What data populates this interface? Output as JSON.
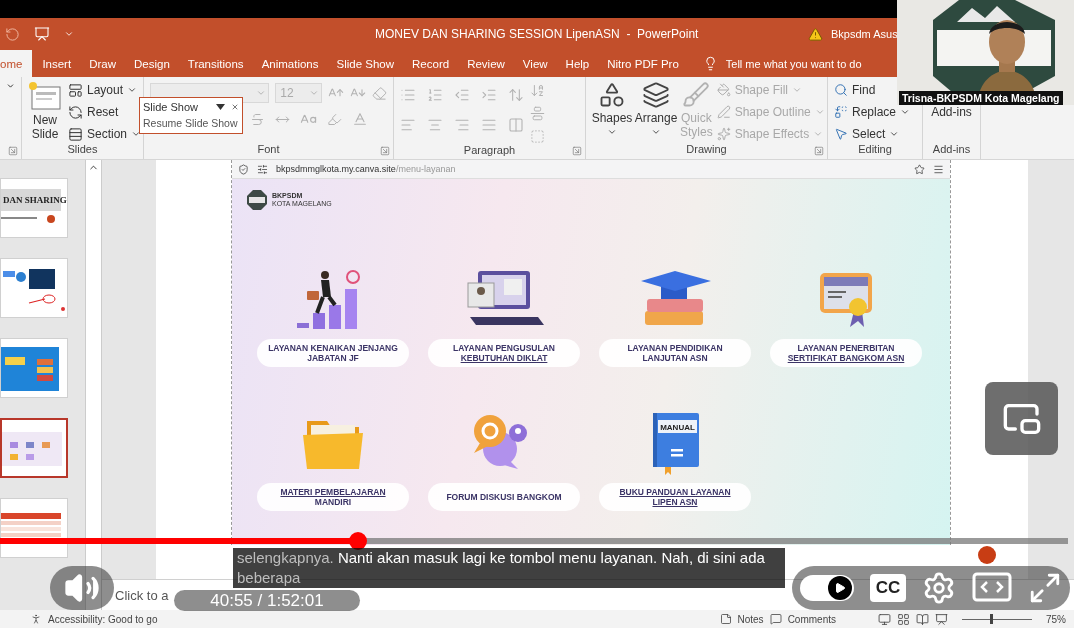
{
  "window": {
    "title": "MONEV DAN SHARING SESSION LipenASN  -  PowerPoint",
    "user": "Bkpsdm Asus"
  },
  "tabs": [
    {
      "label": "ome",
      "selected": true
    },
    {
      "label": "Insert",
      "selected": false
    },
    {
      "label": "Draw",
      "selected": false
    },
    {
      "label": "Design",
      "selected": false
    },
    {
      "label": "Transitions",
      "selected": false
    },
    {
      "label": "Animations",
      "selected": false
    },
    {
      "label": "Slide Show",
      "selected": false
    },
    {
      "label": "Record",
      "selected": false
    },
    {
      "label": "Review",
      "selected": false
    },
    {
      "label": "View",
      "selected": false
    },
    {
      "label": "Help",
      "selected": false
    },
    {
      "label": "Nitro PDF Pro",
      "selected": false
    }
  ],
  "tell_me": {
    "placeholder": "Tell me what you want to do"
  },
  "ribbon": {
    "groups": [
      {
        "kind": "slides",
        "label": "Slides",
        "new_slide": "New Slide",
        "items": [
          {
            "label": "Layout",
            "menu": true
          },
          {
            "label": "Reset",
            "menu": false
          },
          {
            "label": "Section",
            "menu": true
          }
        ]
      },
      {
        "kind": "font",
        "label": "Font",
        "size": "12",
        "disabled": true
      },
      {
        "kind": "paragraph",
        "label": "Paragraph",
        "disabled": true
      },
      {
        "kind": "drawing",
        "label": "Drawing",
        "large": [
          {
            "label": "Shapes",
            "disabled": false
          },
          {
            "label": "Arrange",
            "disabled": false
          },
          {
            "label": "Quick Styles",
            "disabled": true
          }
        ],
        "small": [
          {
            "label": "Shape Fill",
            "disabled": true
          },
          {
            "label": "Shape Outline",
            "disabled": true
          },
          {
            "label": "Shape Effects",
            "disabled": true
          }
        ]
      },
      {
        "kind": "editing",
        "label": "Editing",
        "items": [
          {
            "label": "Find",
            "menu": false
          },
          {
            "label": "Replace",
            "menu": true
          },
          {
            "label": "Select",
            "menu": true
          }
        ]
      },
      {
        "kind": "addins",
        "label": "Add-ins",
        "button": "Add-ins"
      }
    ]
  },
  "popup": {
    "title": "Slide Show",
    "item": "Resume Slide Show"
  },
  "thumbnails": [
    {
      "kind": "title",
      "caption": "DAN SHARING",
      "selected": false
    },
    {
      "kind": "screens",
      "selected": false
    },
    {
      "kind": "books",
      "selected": false
    },
    {
      "kind": "menu",
      "selected": true
    },
    {
      "kind": "table",
      "selected": false
    }
  ],
  "browser": {
    "url_host": "bkpsdmmglkota.my.canva.site",
    "url_path": "/menu-layanan"
  },
  "site": {
    "logo": {
      "name": "BKPSDM",
      "city": "KOTA MAGELANG"
    },
    "services": [
      {
        "kind": "climber",
        "lines": [
          {
            "text": "LAYANAN KENAIKAN JENJANG",
            "underlined": false
          },
          {
            "text": "JABATAN JF",
            "underlined": false
          }
        ]
      },
      {
        "kind": "laptop",
        "lines": [
          {
            "text": "LAYANAN PENGUSULAN",
            "underlined": false
          },
          {
            "text": "KEBUTUHAN DIKLAT",
            "underlined": true
          }
        ]
      },
      {
        "kind": "graduation",
        "lines": [
          {
            "text": "LAYANAN PENDIDIKAN",
            "underlined": false
          },
          {
            "text": "LANJUTAN ASN",
            "underlined": false
          }
        ]
      },
      {
        "kind": "certificate",
        "lines": [
          {
            "text": "LAYANAN PENERBITAN",
            "underlined": false
          },
          {
            "text": "SERTIFIKAT BANGKOM ASN",
            "underlined": true
          }
        ]
      },
      {
        "kind": "folder",
        "lines": [
          {
            "text": "MATERI PEMBELAJARAN",
            "underlined": true
          },
          {
            "text": "MANDIRI",
            "underlined": false
          }
        ]
      },
      {
        "kind": "forum",
        "lines": [
          {
            "text": "FORUM DISKUSI BANGKOM",
            "underlined": false
          }
        ]
      },
      {
        "kind": "manual",
        "icon_text": "MANUAL",
        "lines": [
          {
            "text": "BUKU PANDUAN LAYANAN",
            "underlined": true
          },
          {
            "text": "LIPEN ASN",
            "underlined": true
          }
        ]
      }
    ]
  },
  "notes": {
    "placeholder": "Click to a"
  },
  "status_bar": {
    "accessibility": "Accessibility: Good to go",
    "notes": "Notes",
    "comments": "Comments",
    "zoom": "75%",
    "zoom_slider": {
      "level": 0.4
    }
  },
  "webcam": {
    "name": "Trisna-BKPSDM Kota Magelang"
  },
  "player": {
    "progress": {
      "level": 0.335
    },
    "time": "40:55 / 1:52:01",
    "caption": [
      {
        "text": "selengkapnya.",
        "spoken": false
      },
      {
        "text": " Nanti akan masuk lagi ke tombol menu layanan. Nah, di sini ada ",
        "spoken": true
      },
      {
        "text": "beberapa",
        "spoken": false
      }
    ],
    "autoplay": {
      "on": true
    },
    "cc": "CC"
  }
}
